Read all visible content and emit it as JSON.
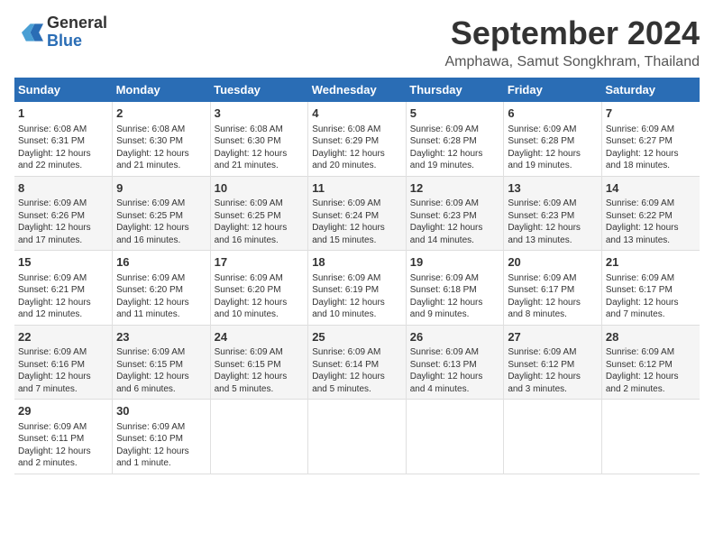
{
  "header": {
    "logo_general": "General",
    "logo_blue": "Blue",
    "main_title": "September 2024",
    "subtitle": "Amphawa, Samut Songkhram, Thailand"
  },
  "days_of_week": [
    "Sunday",
    "Monday",
    "Tuesday",
    "Wednesday",
    "Thursday",
    "Friday",
    "Saturday"
  ],
  "weeks": [
    [
      {
        "day": 1,
        "info": "Sunrise: 6:08 AM\nSunset: 6:31 PM\nDaylight: 12 hours\nand 22 minutes."
      },
      {
        "day": 2,
        "info": "Sunrise: 6:08 AM\nSunset: 6:30 PM\nDaylight: 12 hours\nand 21 minutes."
      },
      {
        "day": 3,
        "info": "Sunrise: 6:08 AM\nSunset: 6:30 PM\nDaylight: 12 hours\nand 21 minutes."
      },
      {
        "day": 4,
        "info": "Sunrise: 6:08 AM\nSunset: 6:29 PM\nDaylight: 12 hours\nand 20 minutes."
      },
      {
        "day": 5,
        "info": "Sunrise: 6:09 AM\nSunset: 6:28 PM\nDaylight: 12 hours\nand 19 minutes."
      },
      {
        "day": 6,
        "info": "Sunrise: 6:09 AM\nSunset: 6:28 PM\nDaylight: 12 hours\nand 19 minutes."
      },
      {
        "day": 7,
        "info": "Sunrise: 6:09 AM\nSunset: 6:27 PM\nDaylight: 12 hours\nand 18 minutes."
      }
    ],
    [
      {
        "day": 8,
        "info": "Sunrise: 6:09 AM\nSunset: 6:26 PM\nDaylight: 12 hours\nand 17 minutes."
      },
      {
        "day": 9,
        "info": "Sunrise: 6:09 AM\nSunset: 6:25 PM\nDaylight: 12 hours\nand 16 minutes."
      },
      {
        "day": 10,
        "info": "Sunrise: 6:09 AM\nSunset: 6:25 PM\nDaylight: 12 hours\nand 16 minutes."
      },
      {
        "day": 11,
        "info": "Sunrise: 6:09 AM\nSunset: 6:24 PM\nDaylight: 12 hours\nand 15 minutes."
      },
      {
        "day": 12,
        "info": "Sunrise: 6:09 AM\nSunset: 6:23 PM\nDaylight: 12 hours\nand 14 minutes."
      },
      {
        "day": 13,
        "info": "Sunrise: 6:09 AM\nSunset: 6:23 PM\nDaylight: 12 hours\nand 13 minutes."
      },
      {
        "day": 14,
        "info": "Sunrise: 6:09 AM\nSunset: 6:22 PM\nDaylight: 12 hours\nand 13 minutes."
      }
    ],
    [
      {
        "day": 15,
        "info": "Sunrise: 6:09 AM\nSunset: 6:21 PM\nDaylight: 12 hours\nand 12 minutes."
      },
      {
        "day": 16,
        "info": "Sunrise: 6:09 AM\nSunset: 6:20 PM\nDaylight: 12 hours\nand 11 minutes."
      },
      {
        "day": 17,
        "info": "Sunrise: 6:09 AM\nSunset: 6:20 PM\nDaylight: 12 hours\nand 10 minutes."
      },
      {
        "day": 18,
        "info": "Sunrise: 6:09 AM\nSunset: 6:19 PM\nDaylight: 12 hours\nand 10 minutes."
      },
      {
        "day": 19,
        "info": "Sunrise: 6:09 AM\nSunset: 6:18 PM\nDaylight: 12 hours\nand 9 minutes."
      },
      {
        "day": 20,
        "info": "Sunrise: 6:09 AM\nSunset: 6:17 PM\nDaylight: 12 hours\nand 8 minutes."
      },
      {
        "day": 21,
        "info": "Sunrise: 6:09 AM\nSunset: 6:17 PM\nDaylight: 12 hours\nand 7 minutes."
      }
    ],
    [
      {
        "day": 22,
        "info": "Sunrise: 6:09 AM\nSunset: 6:16 PM\nDaylight: 12 hours\nand 7 minutes."
      },
      {
        "day": 23,
        "info": "Sunrise: 6:09 AM\nSunset: 6:15 PM\nDaylight: 12 hours\nand 6 minutes."
      },
      {
        "day": 24,
        "info": "Sunrise: 6:09 AM\nSunset: 6:15 PM\nDaylight: 12 hours\nand 5 minutes."
      },
      {
        "day": 25,
        "info": "Sunrise: 6:09 AM\nSunset: 6:14 PM\nDaylight: 12 hours\nand 5 minutes."
      },
      {
        "day": 26,
        "info": "Sunrise: 6:09 AM\nSunset: 6:13 PM\nDaylight: 12 hours\nand 4 minutes."
      },
      {
        "day": 27,
        "info": "Sunrise: 6:09 AM\nSunset: 6:12 PM\nDaylight: 12 hours\nand 3 minutes."
      },
      {
        "day": 28,
        "info": "Sunrise: 6:09 AM\nSunset: 6:12 PM\nDaylight: 12 hours\nand 2 minutes."
      }
    ],
    [
      {
        "day": 29,
        "info": "Sunrise: 6:09 AM\nSunset: 6:11 PM\nDaylight: 12 hours\nand 2 minutes."
      },
      {
        "day": 30,
        "info": "Sunrise: 6:09 AM\nSunset: 6:10 PM\nDaylight: 12 hours\nand 1 minute."
      },
      null,
      null,
      null,
      null,
      null
    ]
  ]
}
